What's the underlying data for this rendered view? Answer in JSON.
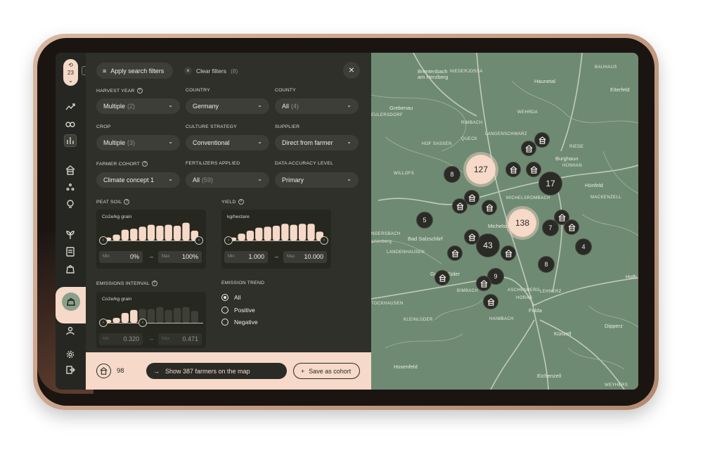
{
  "rail": {
    "year": "23",
    "expand_icon": "chevron-right-icon",
    "icons": [
      "history-icon",
      "trend-icon",
      "link-icon",
      "bar-chart-icon",
      "farm-icon",
      "dots-icon",
      "bulb-icon",
      "plant-icon",
      "report-icon",
      "bag-icon",
      "cohort-bag-icon",
      "user-icon",
      "gear-icon",
      "logout-icon"
    ]
  },
  "header": {
    "apply_label": "Apply search filters",
    "clear_label": "Clear filters",
    "clear_count": "(8)"
  },
  "filters": {
    "harvest_year": {
      "label": "HARVEST YEAR",
      "value": "Multiple",
      "count": "(2)"
    },
    "country": {
      "label": "COUNTRY",
      "value": "Germany"
    },
    "county": {
      "label": "COUNTY",
      "value": "All",
      "count": "(4)"
    },
    "crop": {
      "label": "CROP",
      "value": "Multiple",
      "count": "(3)"
    },
    "culture_strategy": {
      "label": "CULTURE STRATEGY",
      "value": "Conventional"
    },
    "supplier": {
      "label": "SUPPLIER",
      "value": "Direct from farmer"
    },
    "farmer_cohort": {
      "label": "FARMER COHORT",
      "value": "Climate concept 1"
    },
    "fertilizers": {
      "label": "FERTILIZERS APPLIED",
      "value": "All",
      "count": "(59)"
    },
    "accuracy": {
      "label": "DATA ACCURACY LEVEL",
      "value": "Primary"
    }
  },
  "peat_soil": {
    "label": "PEAT SOIL",
    "unit": "Co2e/kg grain",
    "min_label": "Min",
    "min_value": "0%",
    "max_label": "Max",
    "max_value": "100%",
    "bars": [
      0.15,
      0.3,
      0.55,
      0.6,
      0.7,
      0.8,
      0.75,
      0.8,
      0.75,
      0.9,
      0.5
    ]
  },
  "yield": {
    "label": "YIELD",
    "unit": "kg/hectare",
    "min_label": "Min",
    "min_value": "1.000",
    "max_label": "Max",
    "max_value": "10.000",
    "bars": [
      0.15,
      0.35,
      0.5,
      0.65,
      0.7,
      0.75,
      0.85,
      0.8,
      0.85,
      0.85,
      0.45
    ]
  },
  "emissions": {
    "label": "EMISSIONS INTERVAL",
    "unit": "Co2e/kg grain",
    "min_label": "Min",
    "min_value": "0.320",
    "max_label": "Max",
    "max_value": "0.471",
    "bars": [
      0.15,
      0.25,
      0.5,
      0.65,
      0.7,
      0.7,
      0.8,
      0.65,
      0.75,
      0.8,
      0.6
    ]
  },
  "emission_trend": {
    "label": "EMISSION TREND",
    "options": [
      "All",
      "Positive",
      "Negative"
    ],
    "selected": "All"
  },
  "bottom": {
    "cohort_count": "98",
    "show_label": "Show 387 farmers on the map",
    "save_label": "Save as cohort"
  },
  "map": {
    "labels": [
      {
        "text": "Brentenbach",
        "style": "big"
      },
      {
        "text": "am Herzberg",
        "style": "big"
      },
      {
        "text": "NIEDERJOSSA"
      },
      {
        "text": "BAUHAUS"
      },
      {
        "text": "Haunetal",
        "style": "big"
      },
      {
        "text": "Eiterfeld",
        "style": "big"
      },
      {
        "text": "Grebenau",
        "style": "big"
      },
      {
        "text": "EULERSDORF"
      },
      {
        "text": "WEHRDA"
      },
      {
        "text": "RIMBACH"
      },
      {
        "text": "LANGENSCHWARZ"
      },
      {
        "text": "HOF SASSEN"
      },
      {
        "text": "QUECK"
      },
      {
        "text": "RIEDE"
      },
      {
        "text": "Burghaun",
        "style": "big"
      },
      {
        "text": "HÜNHAN"
      },
      {
        "text": "WILLOFS"
      },
      {
        "text": "MICHELSROMBACH"
      },
      {
        "text": "Hünfeld",
        "style": "big"
      },
      {
        "text": "MACKENZELL"
      },
      {
        "text": "NGERSBACH"
      },
      {
        "text": "Bad Salzschlirf",
        "style": "big"
      },
      {
        "text": "artenberg"
      },
      {
        "text": "LANDENHAUSEN"
      },
      {
        "text": "Michelsrombach",
        "style": "big"
      },
      {
        "text": "Großenlüder",
        "style": "big"
      },
      {
        "text": "BIMBACH"
      },
      {
        "text": "ASCHENBERG"
      },
      {
        "text": "LEHNERZ"
      },
      {
        "text": "HORAS"
      },
      {
        "text": "TOCKHAUSEN"
      },
      {
        "text": "Fulda",
        "style": "big"
      },
      {
        "text": "HAIMBACH"
      },
      {
        "text": "KLEINLÜDER"
      },
      {
        "text": "Dipperz",
        "style": "big"
      },
      {
        "text": "Künzell",
        "style": "big"
      },
      {
        "text": "Hosenfeld",
        "style": "big"
      },
      {
        "text": "Eichenzell",
        "style": "big"
      },
      {
        "text": "WEYHERS"
      },
      {
        "text": "Hofb",
        "style": "big"
      }
    ],
    "clusters": [
      {
        "value": "127",
        "kind": "light"
      },
      {
        "value": "138",
        "kind": "light"
      },
      {
        "value": "17",
        "kind": "dark"
      },
      {
        "value": "43",
        "kind": "dark"
      },
      {
        "value": "8",
        "kind": "dark"
      },
      {
        "value": "5",
        "kind": "dark"
      },
      {
        "value": "7",
        "kind": "dark"
      },
      {
        "value": "4",
        "kind": "dark"
      },
      {
        "value": "8",
        "kind": "dark"
      },
      {
        "value": "9",
        "kind": "dark"
      }
    ],
    "pin_icon": "farm-icon",
    "colors": {
      "land": "#6f8a72",
      "roads": "#c9d2c3",
      "accent": "#f6d9c8",
      "dark": "#2a2b26"
    }
  }
}
